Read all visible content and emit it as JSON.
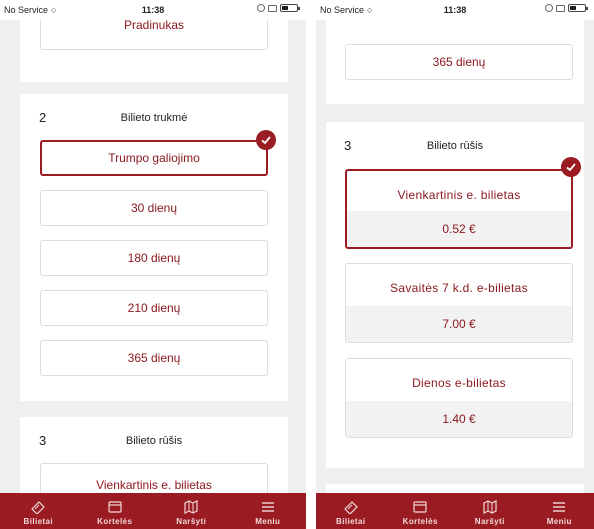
{
  "status_bar": {
    "carrier": "No Service",
    "time": "11:38"
  },
  "left_screen": {
    "top_option": "Pradinukas",
    "duration_section": {
      "number": "2",
      "title": "Bilieto trukmė",
      "options": [
        "Trumpo galiojimo",
        "30 dienų",
        "180 dienų",
        "210 dienų",
        "365 dienų"
      ],
      "selected_option": "Trumpo galiojimo"
    },
    "type_section": {
      "number": "3",
      "title": "Bilieto rūšis",
      "first_ticket": "Vienkartinis e. bilietas"
    }
  },
  "right_screen": {
    "top_option": "365 dienų",
    "type_section": {
      "number": "3",
      "title": "Bilieto rūšis",
      "tickets": [
        {
          "name": "Vienkartinis e. bilietas",
          "price": "0.52 €",
          "selected": true
        },
        {
          "name": "Savaitės 7 k.d. e-bilietas",
          "price": "7.00 €",
          "selected": false
        },
        {
          "name": "Dienos e-bilietas",
          "price": "1.40 €",
          "selected": false
        }
      ]
    }
  },
  "tab_bar": {
    "items": [
      {
        "label": "Bilietai",
        "icon": "ticket-icon"
      },
      {
        "label": "Kortelės",
        "icon": "card-icon"
      },
      {
        "label": "Naršyti",
        "icon": "map-icon"
      },
      {
        "label": "Meniu",
        "icon": "menu-icon"
      }
    ]
  },
  "colors": {
    "accent": "#9a1c22",
    "text_accent": "#8d1a20",
    "background": "#efefef"
  }
}
